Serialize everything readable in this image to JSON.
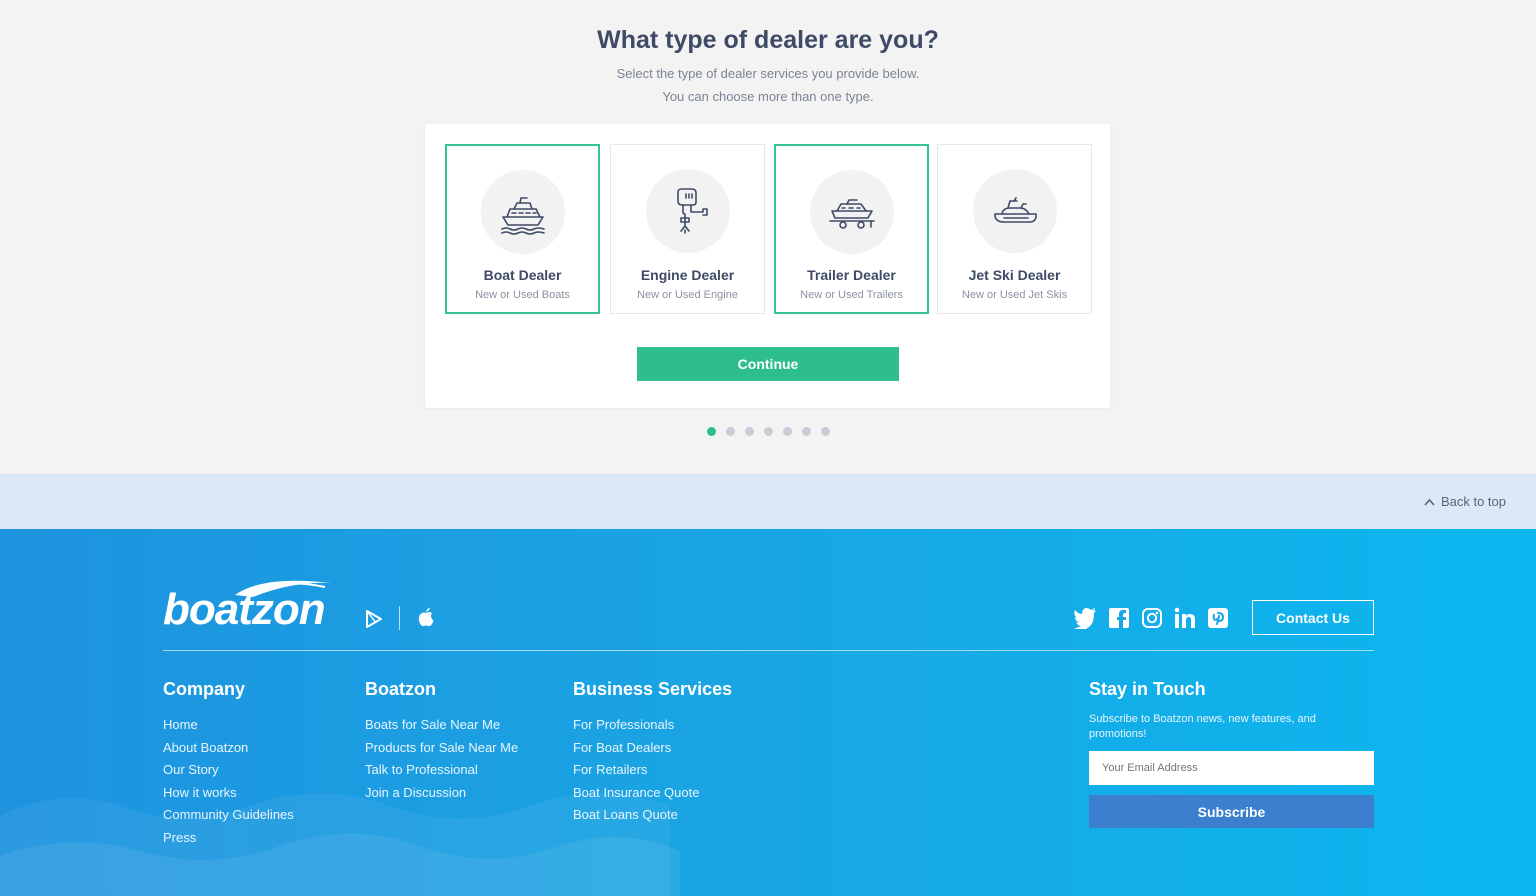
{
  "onboarding": {
    "heading": "What type of dealer are you?",
    "subtitle_1": "Select the type of dealer services you provide below.",
    "subtitle_2": "You can choose more than one type.",
    "options": [
      {
        "title": "Boat Dealer",
        "desc": "New or Used Boats",
        "icon": "boat-icon",
        "selected": true
      },
      {
        "title": "Engine Dealer",
        "desc": "New or Used Engine",
        "icon": "outboard-engine-icon",
        "selected": false
      },
      {
        "title": "Trailer Dealer",
        "desc": "New or Used Trailers",
        "icon": "boat-trailer-icon",
        "selected": true
      },
      {
        "title": "Jet Ski Dealer",
        "desc": "New or Used Jet Skis",
        "icon": "jet-ski-icon",
        "selected": false
      }
    ],
    "continue_label": "Continue",
    "steps_total": 7,
    "steps_active": 1
  },
  "back_to_top": "Back to top",
  "footer": {
    "logo_text": "boatzon",
    "contact_label": "Contact Us",
    "columns": [
      {
        "heading": "Company",
        "links": [
          "Home",
          "About Boatzon",
          "Our Story",
          "How it works",
          "Community Guidelines",
          "Press"
        ]
      },
      {
        "heading": "Boatzon",
        "links": [
          "Boats for Sale Near Me",
          "Products for Sale Near Me",
          "Talk to Professional",
          "Join a Discussion"
        ]
      },
      {
        "heading": "Business Services",
        "links": [
          "For Professionals",
          "For Boat Dealers",
          "For Retailers",
          "Boat Insurance Quote",
          "Boat Loans Quote"
        ]
      }
    ],
    "stay": {
      "heading": "Stay in Touch",
      "text": "Subscribe to Boatzon news, new features, and promotions!",
      "email_placeholder": "Your Email Address",
      "subscribe_label": "Subscribe"
    },
    "socials": [
      "twitter-icon",
      "facebook-icon",
      "instagram-icon",
      "linkedin-icon",
      "pinterest-icon"
    ]
  },
  "colors": {
    "accent_green": "#2ebd8e",
    "heading": "#3f4a66",
    "footer_blue": "#19a6e4",
    "subscribe_blue": "#3c7fcf"
  }
}
